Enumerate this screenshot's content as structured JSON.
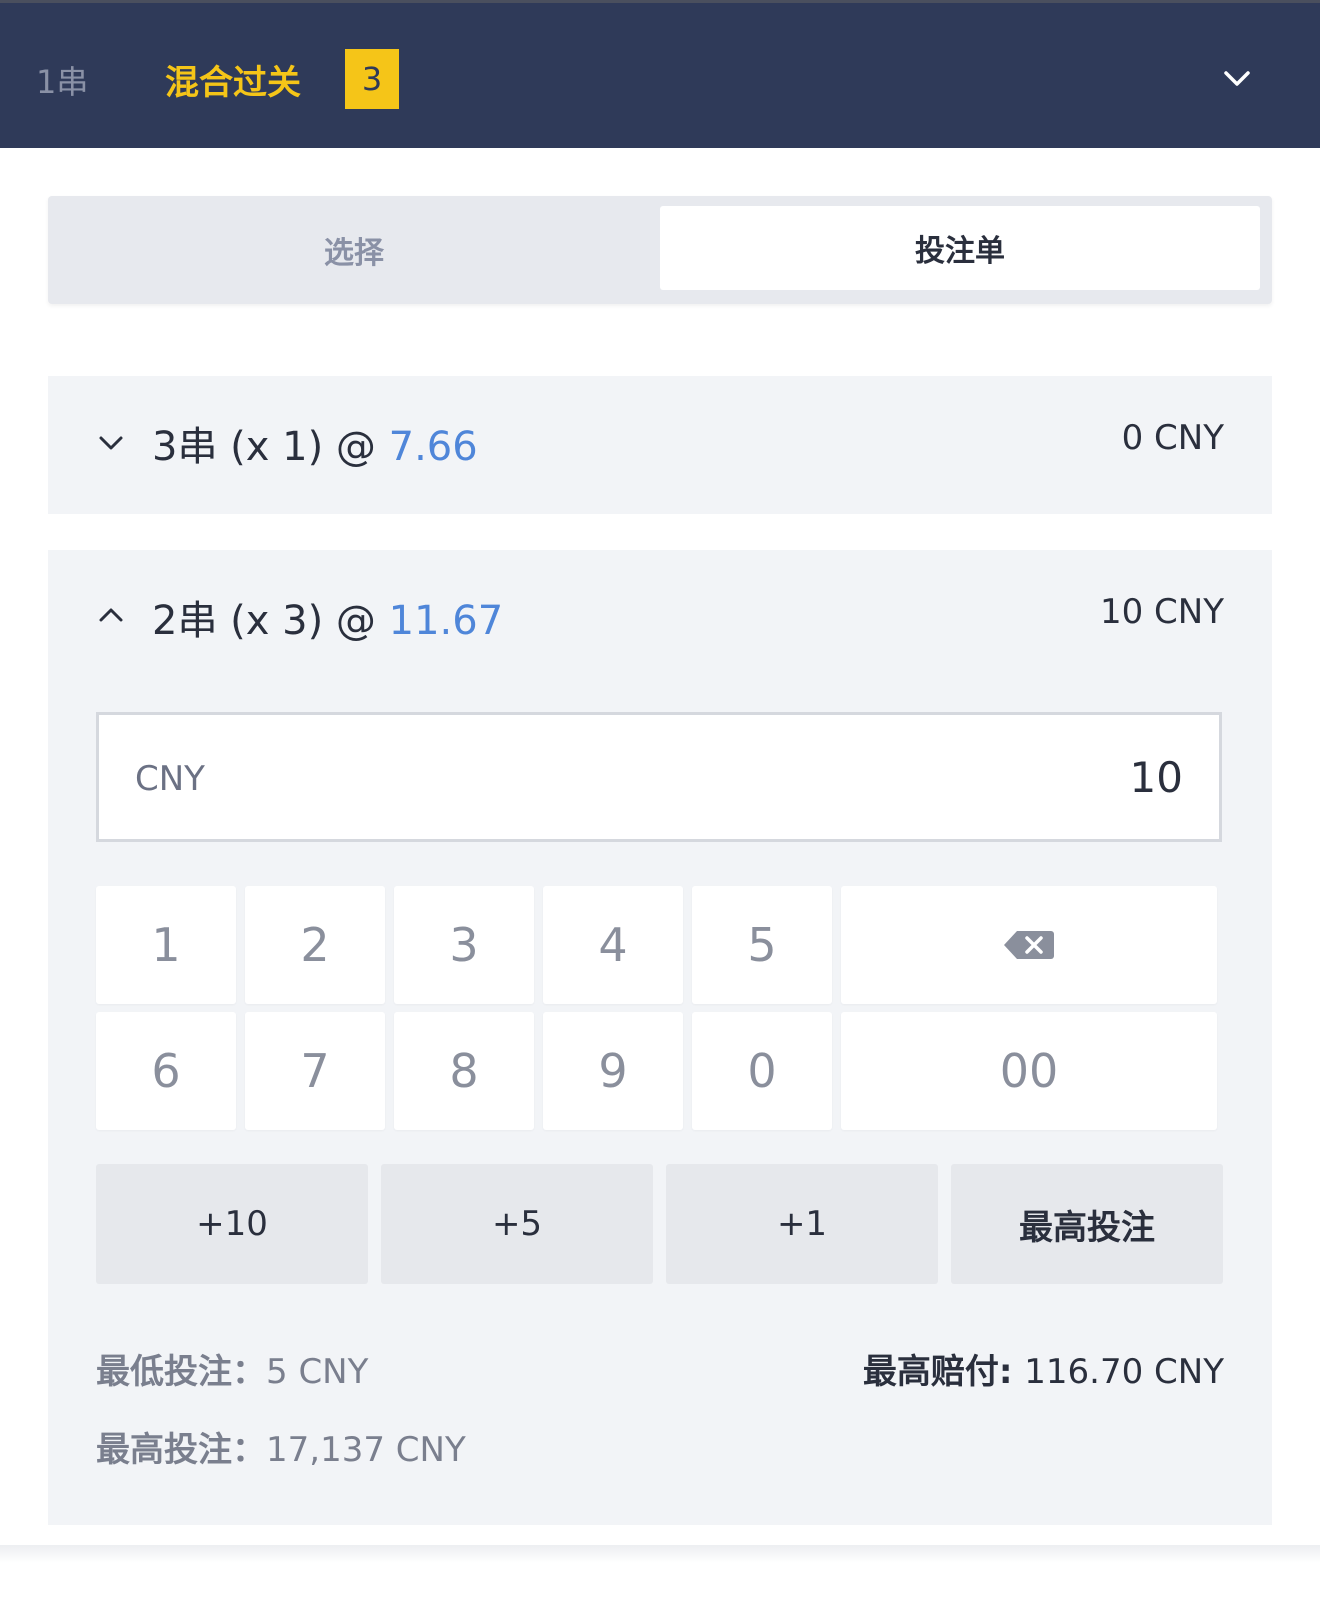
{
  "header": {
    "tab_single": "1串",
    "tab_parlay": "混合过关",
    "parlay_count": "3"
  },
  "segment": {
    "left_label": "选择",
    "right_label": "投注单"
  },
  "bets": [
    {
      "title": "3串 (x 1) @ ",
      "odds": "7.66",
      "amount": "0 CNY",
      "expanded": false
    },
    {
      "title": "2串 (x 3) @ ",
      "odds": "11.67",
      "amount": "10 CNY",
      "expanded": true
    }
  ],
  "stake_input": {
    "currency": "CNY",
    "value": "10"
  },
  "keypad": {
    "row1": [
      "1",
      "2",
      "3",
      "4",
      "5"
    ],
    "row2": [
      "6",
      "7",
      "8",
      "9",
      "0"
    ],
    "double_zero": "00",
    "backspace_icon": "backspace-icon"
  },
  "quick_buttons": [
    "+10",
    "+5",
    "+1",
    "最高投注"
  ],
  "limits": {
    "min_label": "最低投注：",
    "min_value": "5 CNY",
    "max_label": "最高投注：",
    "max_value": "17,137 CNY",
    "payout_label": "最高赔付: ",
    "payout_value": "116.70 CNY"
  },
  "colors": {
    "header_bg": "#2f3a59",
    "accent": "#f5c518",
    "odds": "#4f86d9"
  }
}
